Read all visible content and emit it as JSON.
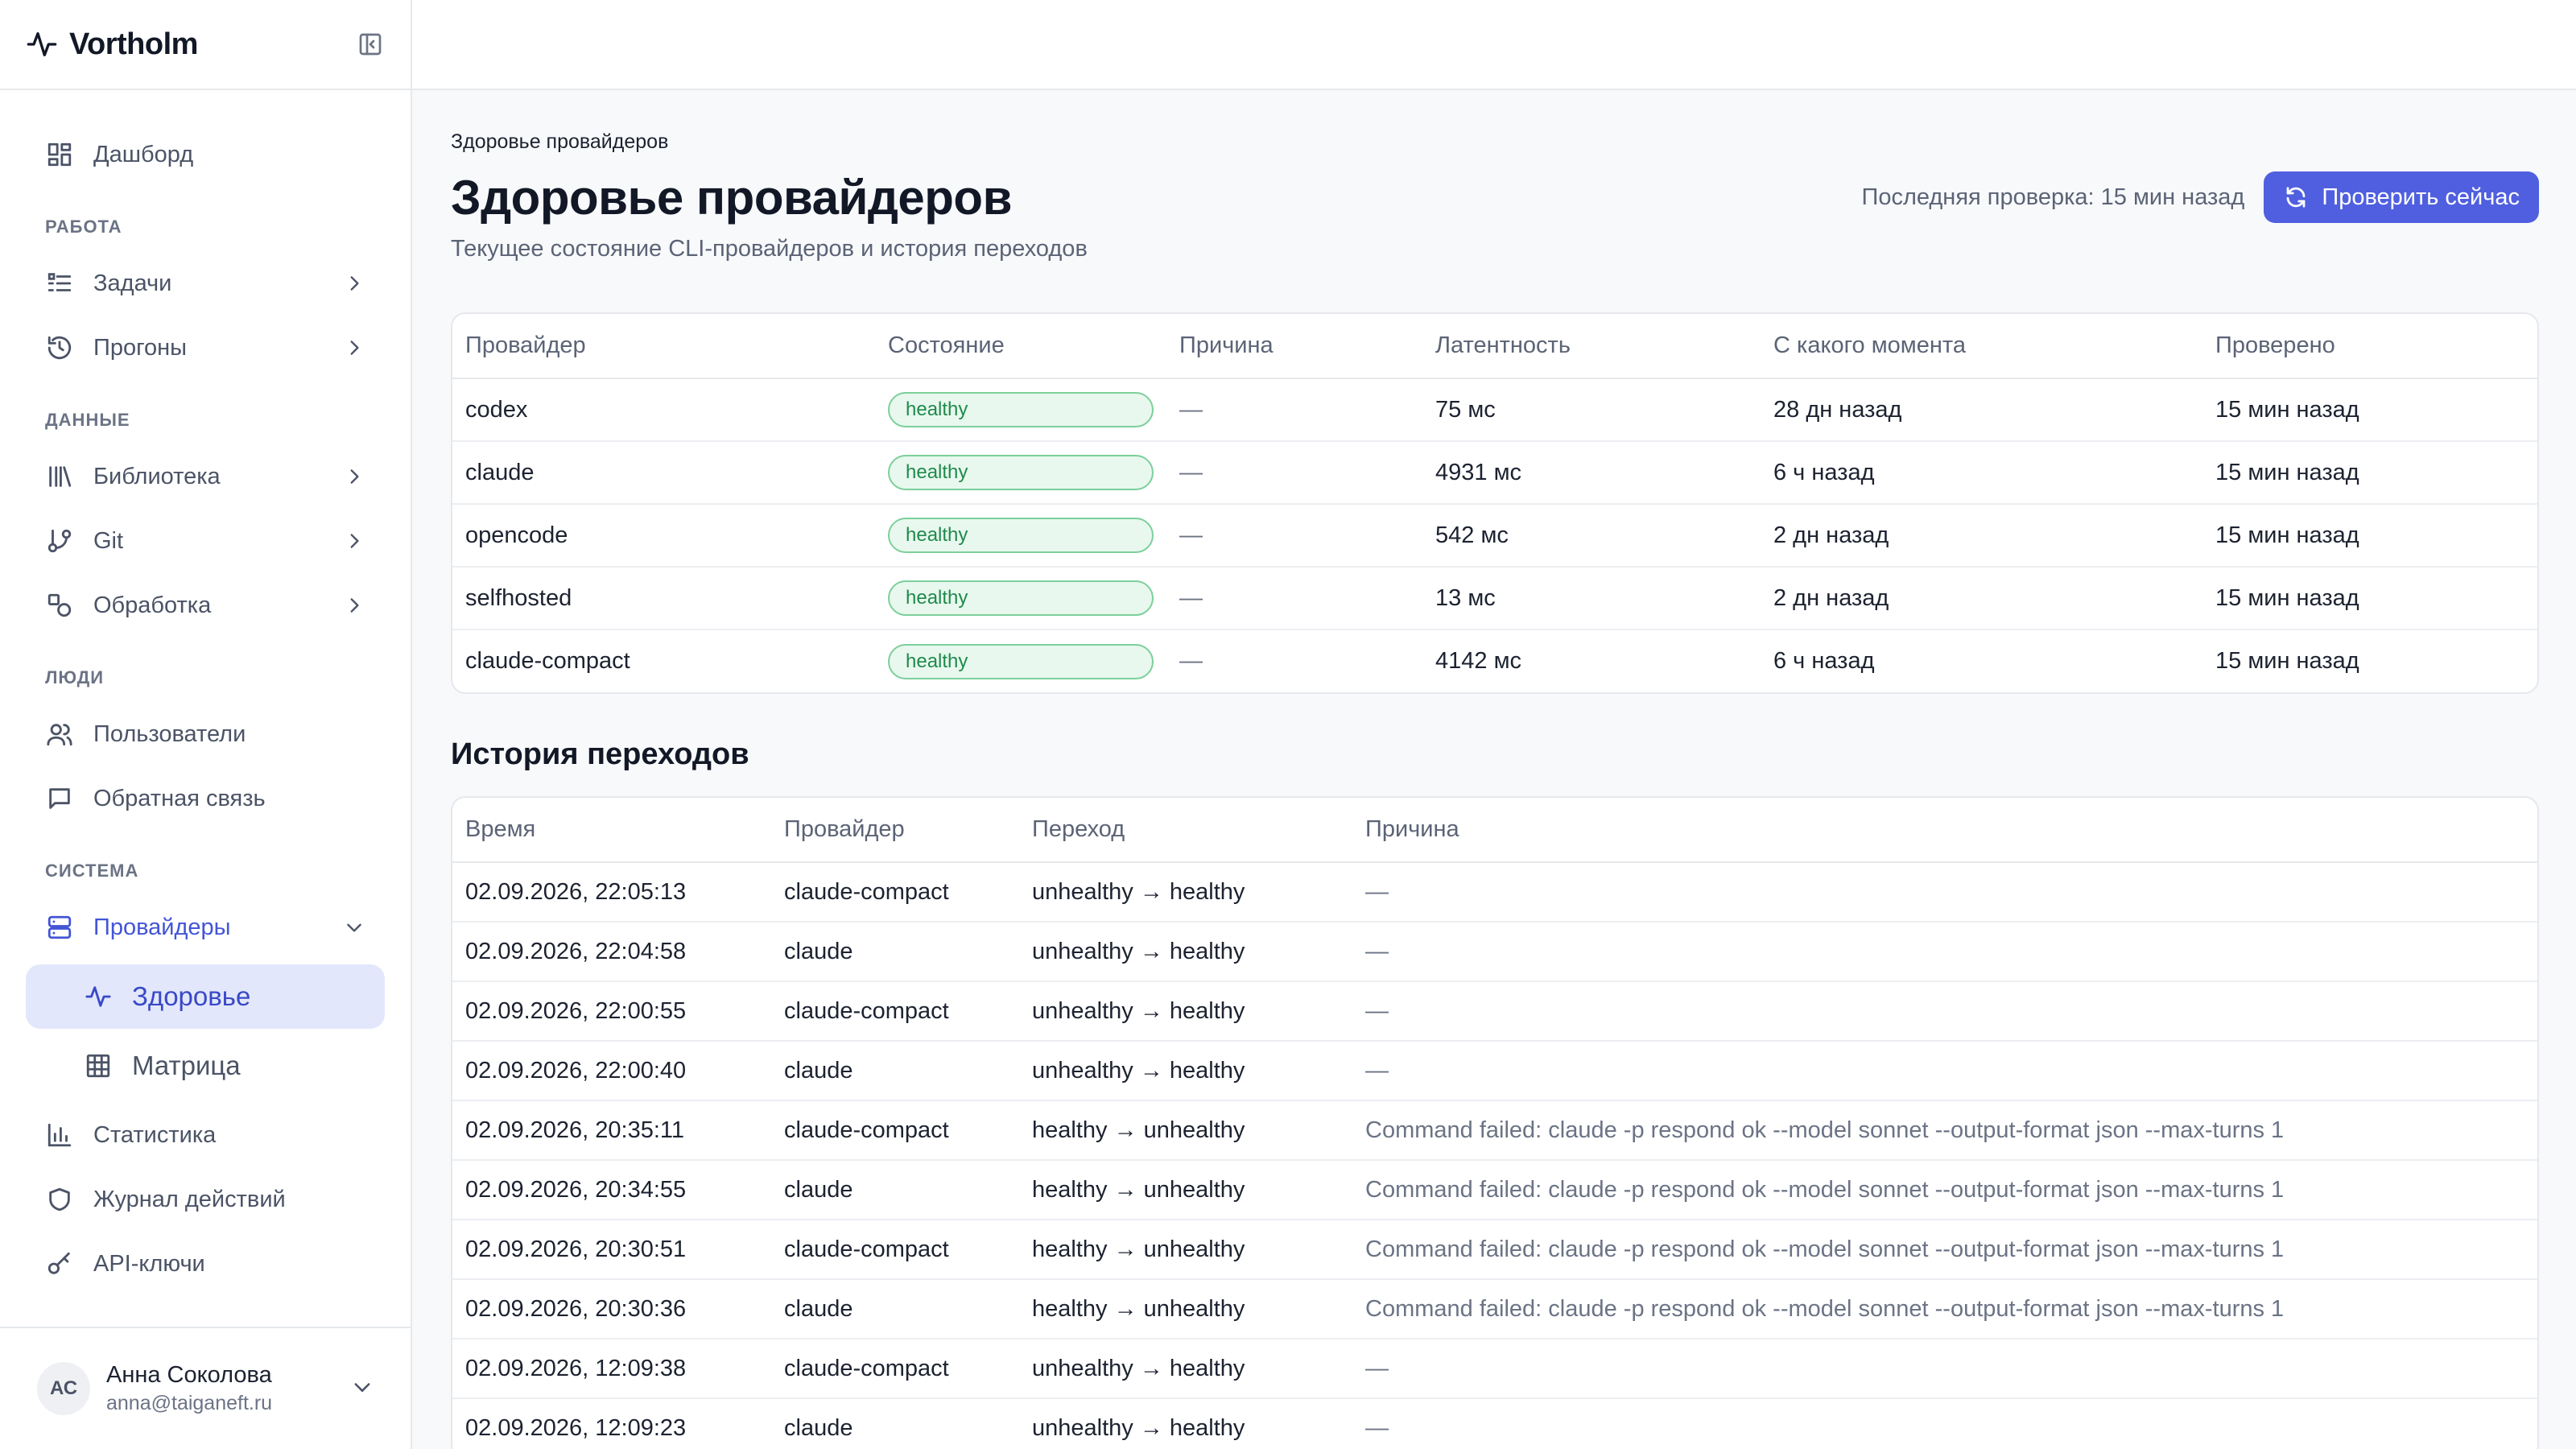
{
  "app": {
    "name": "Vortholm"
  },
  "sidebar": {
    "items": [
      {
        "label": "Дашборд"
      }
    ],
    "sections": {
      "work": {
        "title": "РАБОТА",
        "items": [
          {
            "label": "Задачи"
          },
          {
            "label": "Прогоны"
          }
        ]
      },
      "data": {
        "title": "ДАННЫЕ",
        "items": [
          {
            "label": "Библиотека"
          },
          {
            "label": "Git"
          },
          {
            "label": "Обработка"
          }
        ]
      },
      "people": {
        "title": "ЛЮДИ",
        "items": [
          {
            "label": "Пользователи"
          },
          {
            "label": "Обратная связь"
          }
        ]
      },
      "system": {
        "title": "СИСТЕМА",
        "items": [
          {
            "label": "Провайдеры"
          },
          {
            "label": "Здоровье"
          },
          {
            "label": "Матрица"
          },
          {
            "label": "Статистика"
          },
          {
            "label": "Журнал действий"
          },
          {
            "label": "API-ключи"
          }
        ]
      }
    },
    "user": {
      "initials": "АС",
      "name": "Анна Соколова",
      "email": "anna@taiganeft.ru"
    }
  },
  "page": {
    "breadcrumb": "Здоровье провайдеров",
    "title": "Здоровье провайдеров",
    "subtitle": "Текущее состояние CLI-провайдеров и история переходов",
    "last_check": "Последняя проверка: 15 мин назад",
    "check_now": "Проверить сейчас"
  },
  "providers_table": {
    "headers": [
      "Провайдер",
      "Состояние",
      "Причина",
      "Латентность",
      "С какого момента",
      "Проверено"
    ],
    "rows": [
      {
        "provider": "codex",
        "state": "healthy",
        "reason": "—",
        "latency": "75 мс",
        "since": "28 дн назад",
        "checked": "15 мин назад"
      },
      {
        "provider": "claude",
        "state": "healthy",
        "reason": "—",
        "latency": "4931 мс",
        "since": "6 ч назад",
        "checked": "15 мин назад"
      },
      {
        "provider": "opencode",
        "state": "healthy",
        "reason": "—",
        "latency": "542 мс",
        "since": "2 дн назад",
        "checked": "15 мин назад"
      },
      {
        "provider": "selfhosted",
        "state": "healthy",
        "reason": "—",
        "latency": "13 мс",
        "since": "2 дн назад",
        "checked": "15 мин назад"
      },
      {
        "provider": "claude-compact",
        "state": "healthy",
        "reason": "—",
        "latency": "4142 мс",
        "since": "6 ч назад",
        "checked": "15 мин назад"
      }
    ]
  },
  "history": {
    "title": "История переходов",
    "headers": [
      "Время",
      "Провайдер",
      "Переход",
      "Причина"
    ],
    "rows": [
      {
        "time": "02.09.2026, 22:05:13",
        "provider": "claude-compact",
        "transition": "unhealthy → healthy",
        "reason": "—"
      },
      {
        "time": "02.09.2026, 22:04:58",
        "provider": "claude",
        "transition": "unhealthy → healthy",
        "reason": "—"
      },
      {
        "time": "02.09.2026, 22:00:55",
        "provider": "claude-compact",
        "transition": "unhealthy → healthy",
        "reason": "—"
      },
      {
        "time": "02.09.2026, 22:00:40",
        "provider": "claude",
        "transition": "unhealthy → healthy",
        "reason": "—"
      },
      {
        "time": "02.09.2026, 20:35:11",
        "provider": "claude-compact",
        "transition": "healthy → unhealthy",
        "reason": "Command failed: claude -p respond ok --model sonnet --output-format json --max-turns 1"
      },
      {
        "time": "02.09.2026, 20:34:55",
        "provider": "claude",
        "transition": "healthy → unhealthy",
        "reason": "Command failed: claude -p respond ok --model sonnet --output-format json --max-turns 1"
      },
      {
        "time": "02.09.2026, 20:30:51",
        "provider": "claude-compact",
        "transition": "healthy → unhealthy",
        "reason": "Command failed: claude -p respond ok --model sonnet --output-format json --max-turns 1"
      },
      {
        "time": "02.09.2026, 20:30:36",
        "provider": "claude",
        "transition": "healthy → unhealthy",
        "reason": "Command failed: claude -p respond ok --model sonnet --output-format json --max-turns 1"
      },
      {
        "time": "02.09.2026, 12:09:38",
        "provider": "claude-compact",
        "transition": "unhealthy → healthy",
        "reason": "—"
      },
      {
        "time": "02.09.2026, 12:09:23",
        "provider": "claude",
        "transition": "unhealthy → healthy",
        "reason": "—"
      }
    ]
  },
  "colors": {
    "accent": "#4f5fe0",
    "active_bg": "#e3e7fb",
    "healthy_text": "#1f8a4c",
    "healthy_bg": "#e8f8ee",
    "healthy_border": "#7ccf9b"
  },
  "icons": {
    "logo": "pulse-icon",
    "collapse": "sidebar-collapse-icon",
    "refresh": "refresh-icon"
  }
}
